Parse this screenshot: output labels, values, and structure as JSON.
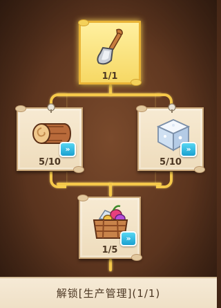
{
  "tree": {
    "root": {
      "icon": "shovel-icon",
      "count": "1/1"
    },
    "left": {
      "icon": "log-icon",
      "count": "5/10",
      "badge_icon": "fast-forward-icon"
    },
    "right": {
      "icon": "ice-block-icon",
      "count": "5/10",
      "badge_icon": "fast-forward-icon"
    },
    "bottom": {
      "icon": "resource-basket-icon",
      "count": "1/5",
      "badge_icon": "fast-forward-icon"
    }
  },
  "footer": {
    "label": "解锁[生产管理](1/1)"
  },
  "colors": {
    "connector": "#f5c84a",
    "badge": "#1aa0d0",
    "parchment": "#f3e4c8"
  }
}
